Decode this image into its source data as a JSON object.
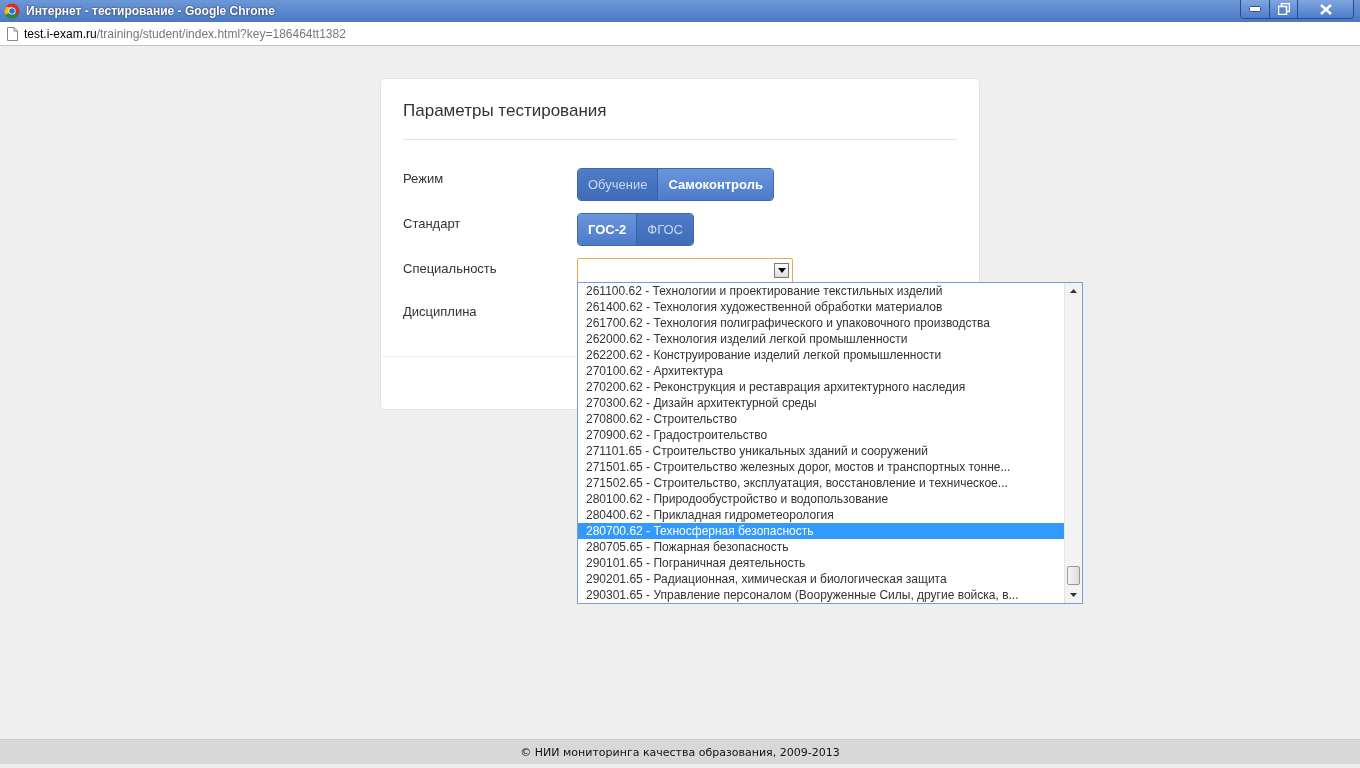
{
  "window": {
    "title": "Интернет - тестирование - Google Chrome"
  },
  "address_bar": {
    "host": "test.i-exam.ru",
    "path": "/training/student/index.html?key=186464tt1382"
  },
  "form": {
    "title": "Параметры тестирования",
    "fields": [
      {
        "kind": "toggle",
        "label": "Режим",
        "options": [
          {
            "label": "Обучение",
            "selected": false
          },
          {
            "label": "Самоконтроль",
            "selected": true
          }
        ]
      },
      {
        "kind": "toggle",
        "label": "Стандарт",
        "options": [
          {
            "label": "ГОС-2",
            "selected": true
          },
          {
            "label": "ФГОС",
            "selected": false
          }
        ]
      },
      {
        "kind": "select",
        "label": "Специальность",
        "expanded": true,
        "options": [
          {
            "label": "261100.62 - Технологии и проектирование текстильных изделий",
            "selected": false
          },
          {
            "label": "261400.62 - Технология художественной обработки материалов",
            "selected": false
          },
          {
            "label": "261700.62 - Технология полиграфического и упаковочного производства",
            "selected": false
          },
          {
            "label": "262000.62 - Технология изделий легкой промышленности",
            "selected": false
          },
          {
            "label": "262200.62 - Конструирование изделий легкой промышленности",
            "selected": false
          },
          {
            "label": "270100.62 - Архитектура",
            "selected": false
          },
          {
            "label": "270200.62 - Реконструкция и реставрация архитектурного наследия",
            "selected": false
          },
          {
            "label": "270300.62 - Дизайн архитектурной среды",
            "selected": false
          },
          {
            "label": "270800.62 - Строительство",
            "selected": false
          },
          {
            "label": "270900.62 - Градостроительство",
            "selected": false
          },
          {
            "label": "271101.65 - Строительство уникальных зданий и сооружений",
            "selected": false
          },
          {
            "label": "271501.65 - Строительство железных дорог, мостов и транспортных тонне...",
            "selected": false
          },
          {
            "label": "271502.65 - Строительство, эксплуатация, восстановление и техническое...",
            "selected": false
          },
          {
            "label": "280100.62 - Природообустройство и водопользование",
            "selected": false
          },
          {
            "label": "280400.62 - Прикладная гидрометеорология",
            "selected": false
          },
          {
            "label": "280700.62 - Техносферная безопасность",
            "selected": true
          },
          {
            "label": "280705.65 - Пожарная безопасность",
            "selected": false
          },
          {
            "label": "290101.65 - Пограничная деятельность",
            "selected": false
          },
          {
            "label": "290201.65 - Радиационная, химическая и биологическая защита",
            "selected": false
          },
          {
            "label": "290301.65 - Управление персоналом (Вооруженные Силы, другие войска, в...",
            "selected": false
          }
        ]
      },
      {
        "kind": "label",
        "label": "Дисциплина"
      }
    ]
  },
  "footer": {
    "text": "© НИИ мониторинга качества образования, 2009-2013"
  }
}
